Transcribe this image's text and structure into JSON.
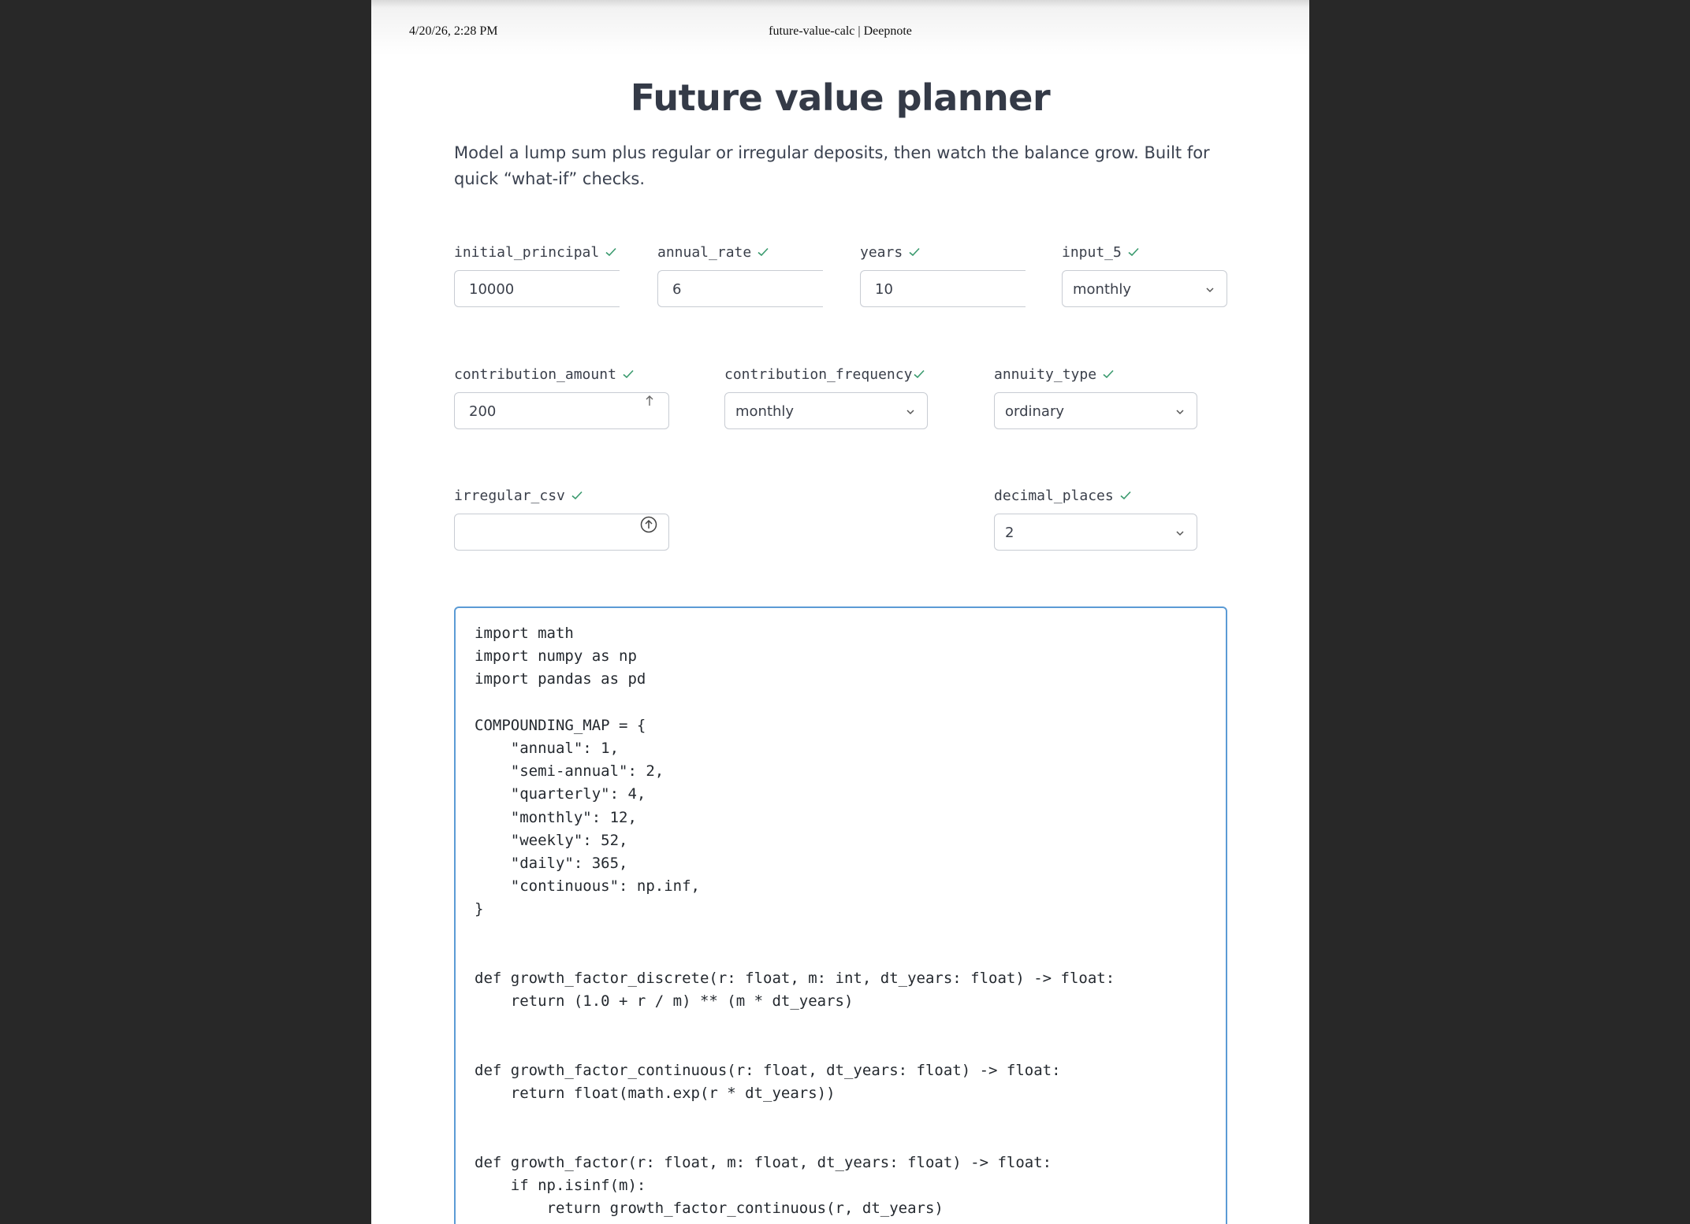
{
  "print_header": {
    "date": "4/20/26, 2:28 PM",
    "title": "future-value-calc | Deepnote"
  },
  "notebook": {
    "title": "Future value planner",
    "description": "Model a lump sum plus regular or irregular deposits, then watch the balance grow. Built for quick “what-if” checks."
  },
  "inputs": {
    "initial_principal": {
      "label": "initial_principal",
      "value": "10000"
    },
    "annual_rate": {
      "label": "annual_rate",
      "value": "6"
    },
    "years": {
      "label": "years",
      "value": "10"
    },
    "input_5": {
      "label": "input_5",
      "value": "monthly"
    },
    "contribution_amount": {
      "label": "contribution_amount",
      "value": "200"
    },
    "contribution_frequency": {
      "label": "contribution_frequency",
      "value": "monthly"
    },
    "annuity_type": {
      "label": "annuity_type",
      "value": "ordinary"
    },
    "irregular_csv": {
      "label": "irregular_csv",
      "value": ""
    },
    "decimal_places": {
      "label": "decimal_places",
      "value": "2"
    }
  },
  "code_cell": {
    "source": "import math\nimport numpy as np\nimport pandas as pd\n\nCOMPOUNDING_MAP = {\n    \"annual\": 1,\n    \"semi-annual\": 2,\n    \"quarterly\": 4,\n    \"monthly\": 12,\n    \"weekly\": 52,\n    \"daily\": 365,\n    \"continuous\": np.inf,\n}\n\n\ndef growth_factor_discrete(r: float, m: int, dt_years: float) -> float:\n    return (1.0 + r / m) ** (m * dt_years)\n\n\ndef growth_factor_continuous(r: float, dt_years: float) -> float:\n    return float(math.exp(r * dt_years))\n\n\ndef growth_factor(r: float, m: float, dt_years: float) -> float:\n    if np.isinf(m):\n        return growth_factor_continuous(r, dt_years)"
  },
  "colors": {
    "check": "#3a9a6e",
    "focus_border": "#5b9bd5",
    "title": "#343a47"
  }
}
